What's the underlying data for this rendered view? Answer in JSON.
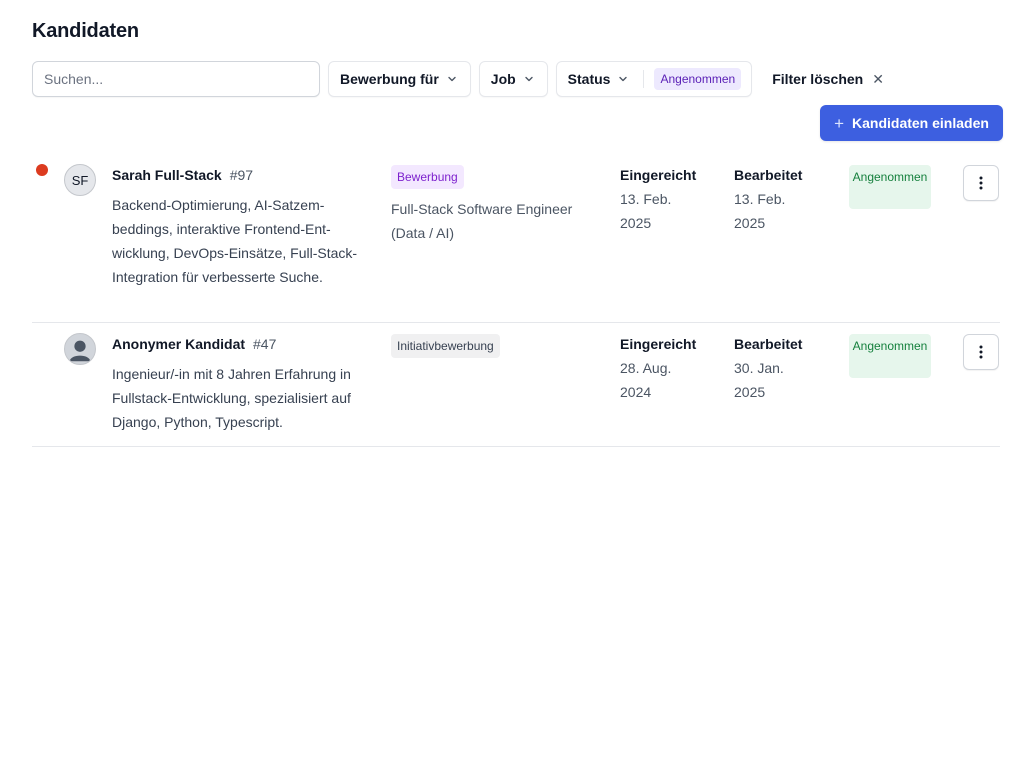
{
  "page": {
    "title": "Kandidaten"
  },
  "filters": {
    "search_placeholder": "Suchen...",
    "application_for_label": "Bewerbung für",
    "job_label": "Job",
    "status_label": "Status",
    "status_selected": "Angenommen",
    "clear_label": "Filter löschen",
    "clear_icon": "close-icon"
  },
  "actions": {
    "invite_label": "Kandidaten einladen",
    "invite_icon": "plus-icon"
  },
  "colors": {
    "accent": "#3d5fe0",
    "unread_dot": "#dc3b1f",
    "accepted_bg": "#e6f6ec",
    "accepted_text": "#15803d"
  },
  "candidates": [
    {
      "initials": "SF",
      "unread": true,
      "name": "Sarah Full-Stack",
      "id": "#97",
      "description": "Backend-Optimierung, AI-Satzem­beddings, interaktive Frontend-Ent­wicklung, DevOps-Einsätze, Full-Stack-Integration für verbesserte Suche.",
      "type": "Bewerbung",
      "job": "Full-Stack Software Engineer (Data / AI)",
      "submitted_label": "Eingereicht",
      "submitted_date": "13. Feb. 2025",
      "edited_label": "Bearbeitet",
      "edited_date": "13. Feb. 2025",
      "status": "Angenom­men"
    },
    {
      "initials": "",
      "unread": false,
      "name": "Anonymer Kandidat",
      "id": "#47",
      "description": "Ingenieur/-in mit 8 Jahren Erfahrung in Fullstack-Entwicklung, spezialisiert auf Django, Python, Typescript.",
      "type": "Initiativbewerbung",
      "job": "",
      "submitted_label": "Eingereicht",
      "submitted_date": "28. Aug. 2024",
      "edited_label": "Bearbeitet",
      "edited_date": "30. Jan. 2025",
      "status": "Angenom­men"
    }
  ]
}
